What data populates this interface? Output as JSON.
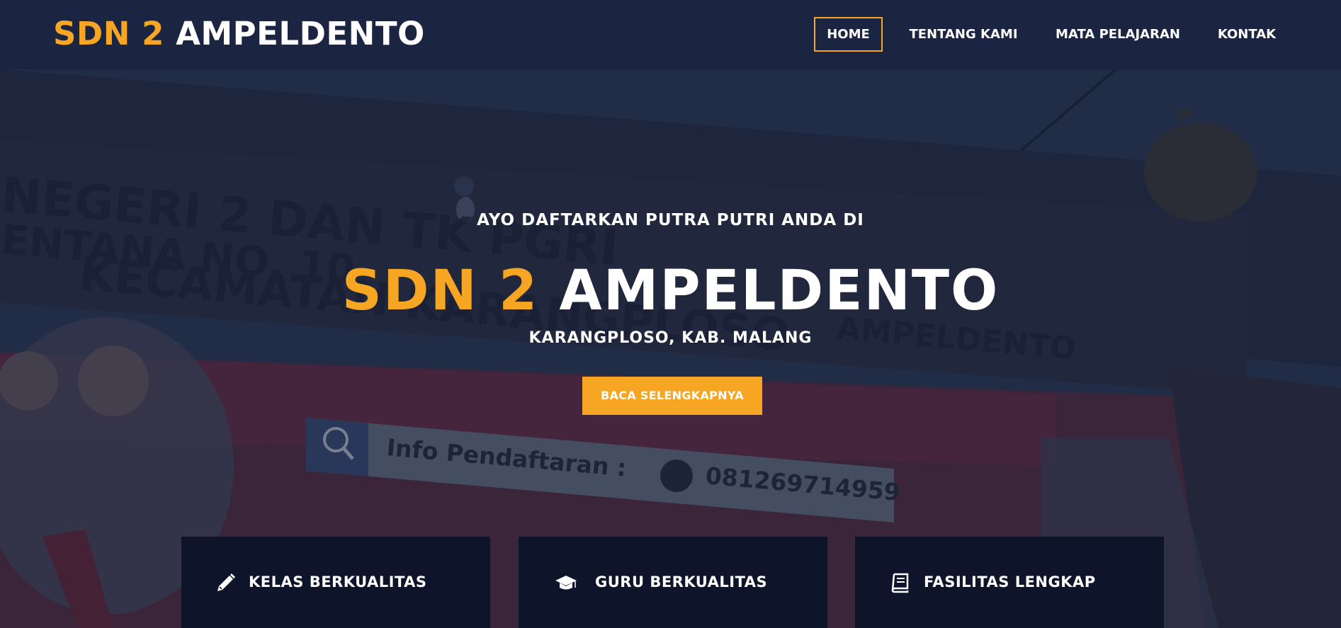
{
  "navbar": {
    "brand": {
      "accent": "SDN 2",
      "main": "AMPELDENTO"
    },
    "items": [
      {
        "label": "HOME",
        "active": true
      },
      {
        "label": "TENTANG KAMI",
        "active": false
      },
      {
        "label": "MATA PELAJARAN",
        "active": false
      },
      {
        "label": "KONTAK",
        "active": false
      }
    ]
  },
  "hero": {
    "subtitle": "AYO DAFTARKAN PUTRA PUTRI ANDA DI",
    "title": {
      "accent": "SDN 2",
      "main": "AMPELDENTO"
    },
    "location": "KARANGPLOSO, KAB. MALANG",
    "cta_label": "BACA SELENGKAPNYA",
    "background": {
      "banner_text": "Info Pendaftaran :",
      "banner_phone": "081269714959"
    }
  },
  "features": [
    {
      "label": "KELAS BERKUALITAS",
      "icon": "pencil-icon"
    },
    {
      "label": "GURU BERKUALITAS",
      "icon": "graduation-cap-icon"
    },
    {
      "label": "FASILITAS LENGKAP",
      "icon": "book-icon"
    }
  ],
  "colors": {
    "accent": "#f6a623",
    "navbar_bg": "#1b2541",
    "card_bg": "#0e1429",
    "text": "#ffffff"
  }
}
